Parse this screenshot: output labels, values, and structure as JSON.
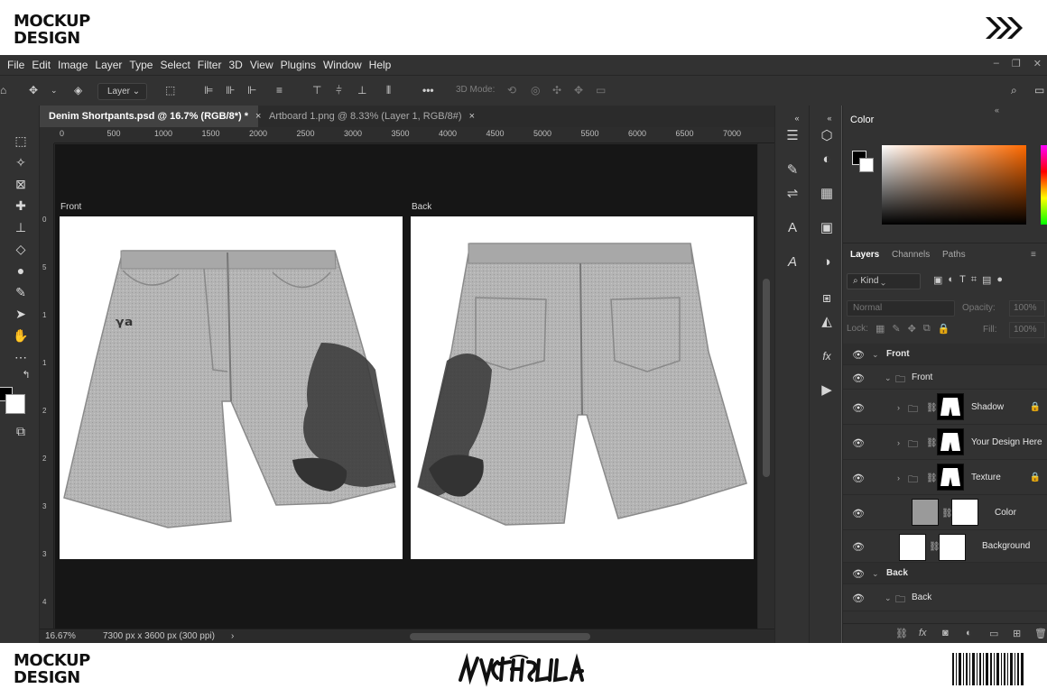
{
  "brand": {
    "line1": "MOCKUP",
    "line2": "DESIGN"
  },
  "signature_text": "NYCTHOPHILIA",
  "menubar": {
    "items": [
      "File",
      "Edit",
      "Image",
      "Layer",
      "Type",
      "Select",
      "Filter",
      "3D",
      "View",
      "Plugins",
      "Window",
      "Help"
    ]
  },
  "window_controls": [
    "–",
    "❐",
    "✕"
  ],
  "options_bar": {
    "layer_select": "Layer",
    "more": "•••",
    "mode3d": "3D Mode:"
  },
  "document": {
    "tabs": [
      {
        "title": "Denim Shortpants.psd @ 16.7% (RGB/8*) *",
        "close": "×"
      },
      {
        "title": "Artboard 1.png @ 8.33% (Layer 1, RGB/8#)",
        "close": "×"
      }
    ],
    "ruler_h": [
      "0",
      "500",
      "1000",
      "1500",
      "2000",
      "2500",
      "3000",
      "3500",
      "4000",
      "4500",
      "5000",
      "5500",
      "6000",
      "6500",
      "7000"
    ],
    "ruler_v": [
      "0",
      "5",
      "1",
      "1",
      "2",
      "2",
      "3",
      "3",
      "4"
    ],
    "artboards": [
      {
        "name": "Front"
      },
      {
        "name": "Back"
      }
    ],
    "status": {
      "zoom": "16.67%",
      "size": "7300 px x 3600 px (300 ppi)",
      "nav": "›"
    }
  },
  "color_panel": {
    "title": "Color",
    "fg": "#000000",
    "bg": "#ffffff",
    "accent": "#ff6a00"
  },
  "layers_panel": {
    "tabs": [
      "Layers",
      "Channels",
      "Paths"
    ],
    "kind": "Kind",
    "blend": "Normal",
    "opacity_label": "Opacity:",
    "opacity_value": "100%",
    "lock_label": "Lock:",
    "fill_label": "Fill:",
    "fill_value": "100%",
    "layers": [
      {
        "name": "Front",
        "type": "group",
        "level": 0
      },
      {
        "name": "Front",
        "type": "folder",
        "level": 1
      },
      {
        "name": "Shadow",
        "type": "smart",
        "level": 2,
        "locked": true
      },
      {
        "name": "Your Design Here",
        "type": "smart",
        "level": 2,
        "locked": false
      },
      {
        "name": "Texture",
        "type": "smart",
        "level": 2,
        "locked": true
      },
      {
        "name": "Color",
        "type": "fill",
        "level": 2,
        "locked": false
      },
      {
        "name": "Background",
        "type": "fill",
        "level": 1,
        "locked": false
      },
      {
        "name": "Back",
        "type": "group",
        "level": 0
      },
      {
        "name": "Back",
        "type": "folder",
        "level": 1
      }
    ]
  }
}
